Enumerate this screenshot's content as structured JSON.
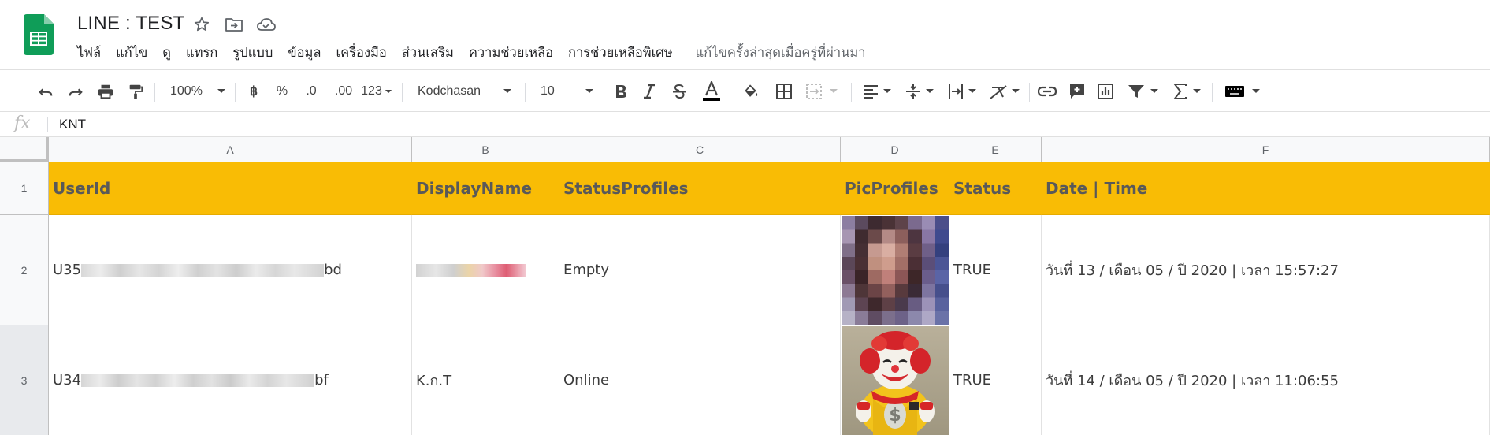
{
  "document": {
    "title": "LINE : TEST",
    "menu": [
      "ไฟล์",
      "แก้ไข",
      "ดู",
      "แทรก",
      "รูปแบบ",
      "ข้อมูล",
      "เครื่องมือ",
      "ส่วนเสริม",
      "ความช่วยเหลือ",
      "การช่วยเหลือพิเศษ"
    ],
    "last_edit": "แก้ไขครั้งล่าสุดเมื่อครู่ที่ผ่านมา"
  },
  "toolbar": {
    "zoom": "100%",
    "currency": "฿",
    "percent": "%",
    "decrease_decimal": ".0",
    "increase_decimal": ".00",
    "more_formats": "123",
    "font": "Kodchasan",
    "font_size": "10"
  },
  "formula": {
    "fx": "fx",
    "value": "KNT"
  },
  "grid": {
    "columns": [
      "A",
      "B",
      "C",
      "D",
      "E",
      "F"
    ],
    "rows": [
      "1",
      "2",
      "3"
    ],
    "header": [
      "UserId",
      "DisplayName",
      "StatusProfiles",
      "PicProfiles",
      "Status",
      "Date | Time"
    ],
    "data": [
      {
        "user_prefix": "U35",
        "user_suffix": "bd",
        "display": "",
        "status_profile": "Empty",
        "status": "TRUE",
        "datetime": "วันที่ 13 / เดือน 05 / ปี 2020 | เวลา 15:57:27"
      },
      {
        "user_prefix": "U34",
        "user_suffix": "bf",
        "display": "K.ก.T",
        "status_profile": "Online",
        "status": "TRUE",
        "datetime": "วันที่ 14 / เดือน 05 / ปี 2020 | เวลา 11:06:55"
      }
    ]
  },
  "colors": {
    "header_fill": "#f9bc05",
    "sheets_green": "#0f9d58"
  }
}
